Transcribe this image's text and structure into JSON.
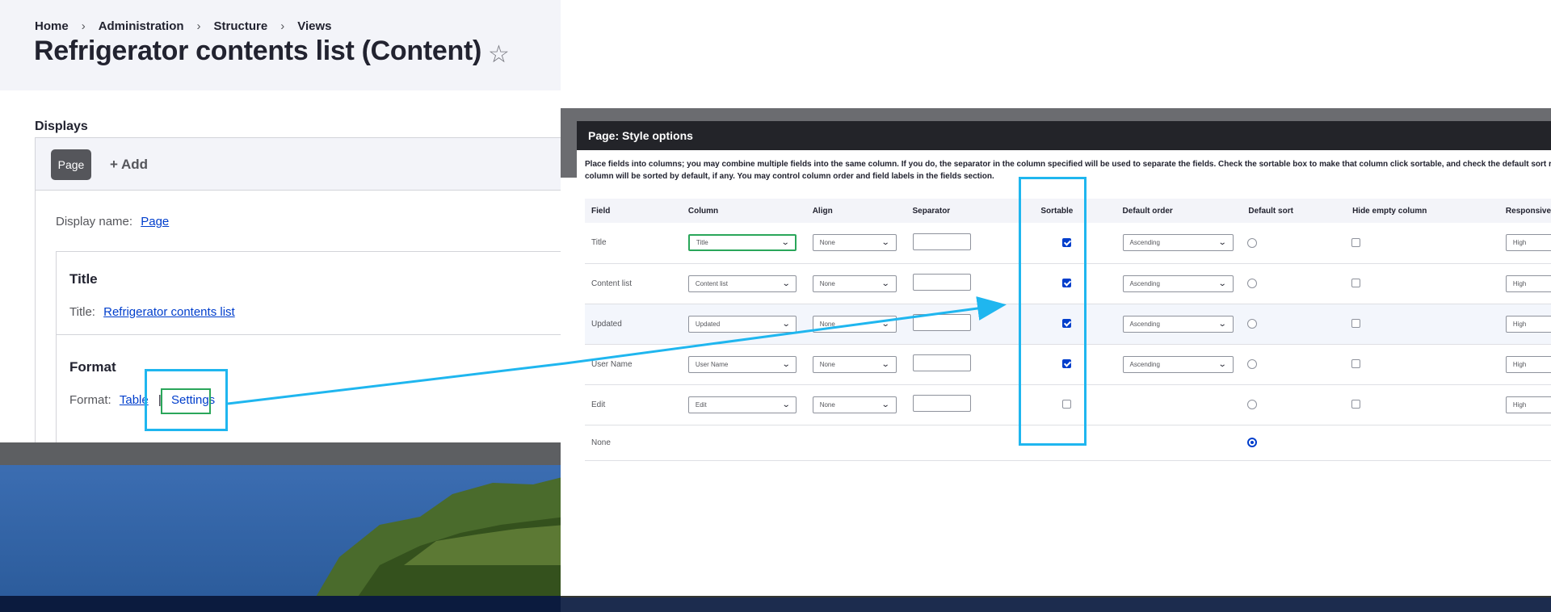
{
  "breadcrumb": [
    "Home",
    "Administration",
    "Structure",
    "Views"
  ],
  "breadcrumb_separator": "›",
  "page_title": "Refrigerator contents list (Content)",
  "star_glyph": "☆",
  "displays": {
    "label": "Displays",
    "active_tab": "Page",
    "add_label": "+ Add",
    "display_name_label": "Display name:",
    "display_name_value": "Page"
  },
  "title_section": {
    "heading": "Title",
    "label": "Title:",
    "value": "Refrigerator contents list"
  },
  "format_section": {
    "heading": "Format",
    "label": "Format:",
    "format_value": "Table",
    "separator": "|",
    "settings_label": "Settings"
  },
  "modal": {
    "title": "Page: Style options",
    "description_line1": "Place fields into columns; you may combine multiple fields into the same column. If you do, the separator in the column specified will be used to separate the fields. Check the sortable box to make that column click sortable, and check the default sort radio to determ",
    "description_line2": "column will be sorted by default, if any. You may control column order and field labels in the fields section.",
    "columns": [
      "Field",
      "Column",
      "Align",
      "Separator",
      "Sortable",
      "Default order",
      "Default sort",
      "Hide empty column",
      "Responsive"
    ],
    "rows": [
      {
        "field": "Title",
        "column": "Title",
        "align": "None",
        "sortable": true,
        "default_order": "Ascending",
        "default_sort": false,
        "hide_empty": false,
        "responsive": "High"
      },
      {
        "field": "Content list",
        "column": "Content list",
        "align": "None",
        "sortable": true,
        "default_order": "Ascending",
        "default_sort": false,
        "hide_empty": false,
        "responsive": "High"
      },
      {
        "field": "Updated",
        "column": "Updated",
        "align": "None",
        "sortable": true,
        "default_order": "Ascending",
        "default_sort": false,
        "hide_empty": false,
        "responsive": "High"
      },
      {
        "field": "User Name",
        "column": "User Name",
        "align": "None",
        "sortable": true,
        "default_order": "Ascending",
        "default_sort": false,
        "hide_empty": false,
        "responsive": "High"
      },
      {
        "field": "Edit",
        "column": "Edit",
        "align": "None",
        "sortable": false,
        "default_order": "",
        "default_sort": false,
        "hide_empty": false,
        "responsive": "High"
      }
    ],
    "none_row_label": "None",
    "none_row_default_sort": true
  },
  "colors": {
    "highlight_blue": "#1fb6ef",
    "highlight_green": "#2aa65a",
    "link_blue": "#003ecc",
    "modal_titlebar": "#232429"
  }
}
